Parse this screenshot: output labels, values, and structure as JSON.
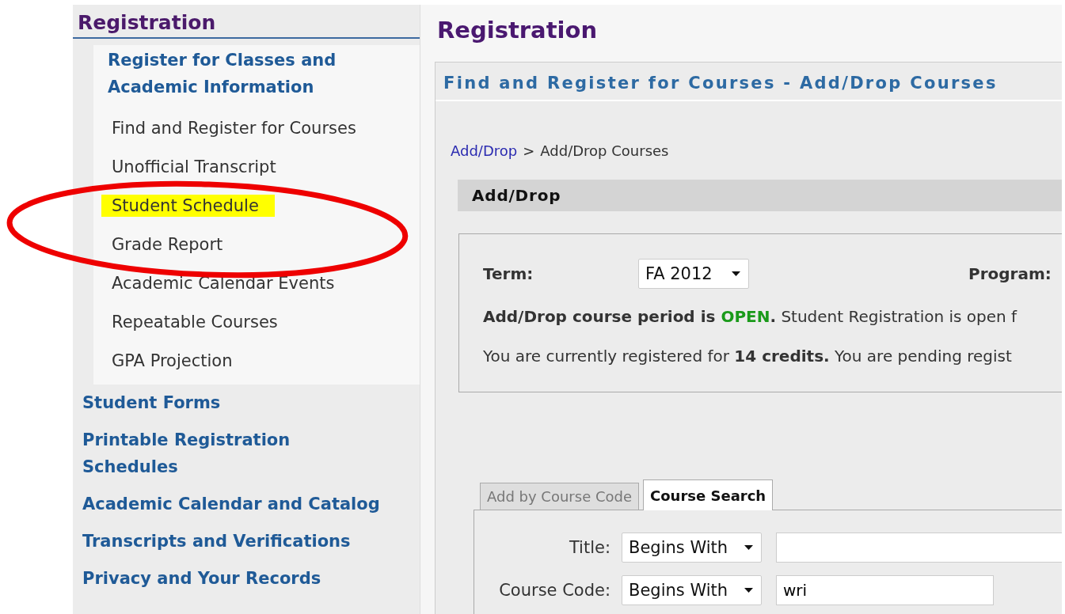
{
  "sidebar": {
    "title": "Registration",
    "sections": [
      {
        "label": "Register for Classes and Academic Information",
        "expanded": true,
        "children": [
          {
            "label": "Find and Register for Courses",
            "highlighted": false
          },
          {
            "label": "Unofficial Transcript",
            "highlighted": false
          },
          {
            "label": "Student Schedule",
            "highlighted": true
          },
          {
            "label": "Grade Report",
            "highlighted": false
          },
          {
            "label": "Academic Calendar Events",
            "highlighted": false
          },
          {
            "label": "Repeatable Courses",
            "highlighted": false
          },
          {
            "label": "GPA Projection",
            "highlighted": false
          }
        ]
      },
      {
        "label": "Student Forms",
        "expanded": false
      },
      {
        "label": "Printable Registration Schedules",
        "expanded": false
      },
      {
        "label": "Academic Calendar and Catalog",
        "expanded": false
      },
      {
        "label": "Transcripts and Verifications",
        "expanded": false
      },
      {
        "label": "Privacy and Your Records",
        "expanded": false
      }
    ]
  },
  "annotation": {
    "kind": "ellipse",
    "color": "#ee0000"
  },
  "main": {
    "title": "Registration",
    "panel_title": "Find and Register for Courses - Add/Drop Courses",
    "breadcrumb": [
      {
        "label": "Add/Drop",
        "kind": "link"
      },
      {
        "label": ">",
        "kind": "separator"
      },
      {
        "label": "Add/Drop Courses",
        "kind": "text"
      }
    ],
    "section_title": "Add/Drop",
    "term": {
      "label": "Term:",
      "value": "FA 2012"
    },
    "program_label": "Program:",
    "status_parts": [
      {
        "text": "Add/Drop course period is ",
        "kind": "emphasis"
      },
      {
        "text": "OPEN",
        "kind": "status"
      },
      {
        "text": ".",
        "kind": "emphasis"
      },
      {
        "text": " Student Registration is open f",
        "kind": "plain"
      }
    ],
    "credits_line": "You are currently registered for **14 credits.** You are pending regist",
    "tabs": [
      {
        "label": "Add by Course Code",
        "selected": false
      },
      {
        "label": "Course Search",
        "selected": true
      }
    ],
    "search_rows": [
      {
        "label": "Title:",
        "operator": "Begins With"
      },
      {
        "label": "Course Code:",
        "operator": "Begins With",
        "value": "wri"
      }
    ]
  }
}
